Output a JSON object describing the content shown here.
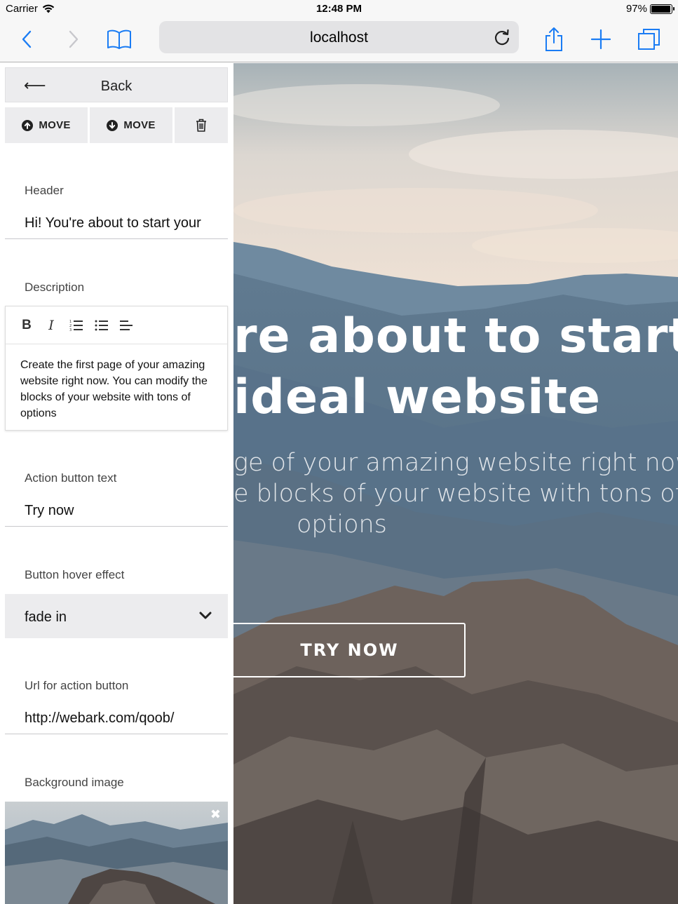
{
  "status_bar": {
    "carrier": "Carrier",
    "time": "12:48 PM",
    "battery_percent": "97%",
    "battery_level": 0.97
  },
  "browser": {
    "url": "localhost",
    "icons": [
      "back-chevron-icon",
      "forward-chevron-icon",
      "bookmarks-book-icon",
      "reload-icon",
      "share-icon",
      "new-tab-plus-icon",
      "tabs-icon"
    ],
    "accent_color": "#1a7cf4"
  },
  "editor_panel": {
    "back_label": "Back",
    "move_up_label": "MOVE",
    "move_down_label": "MOVE",
    "fields": {
      "header": {
        "label": "Header",
        "value": "Hi! You're about to start your"
      },
      "description": {
        "label": "Description",
        "text": "Create the first page of your amazing website right now. You can modify the blocks of your website with tons of options",
        "toolbar": [
          "bold-icon",
          "italic-icon",
          "ordered-list-icon",
          "unordered-list-icon",
          "align-left-icon"
        ]
      },
      "action_button_text": {
        "label": "Action button text",
        "value": "Try now"
      },
      "button_hover_effect": {
        "label": "Button hover effect",
        "value": "fade in"
      },
      "action_url": {
        "label": "Url for action button",
        "value": "http://webark.com/qoob/"
      },
      "background_image": {
        "label": "Background image",
        "close_glyph": "✖"
      }
    }
  },
  "preview": {
    "title_line_1": "re about to start",
    "title_line_2": "ideal website",
    "subtitle_line_1": "ge of your amazing website right now.",
    "subtitle_line_2": "e blocks of your website with tons of",
    "subtitle_line_3": "options",
    "cta_label": "TRY NOW"
  }
}
